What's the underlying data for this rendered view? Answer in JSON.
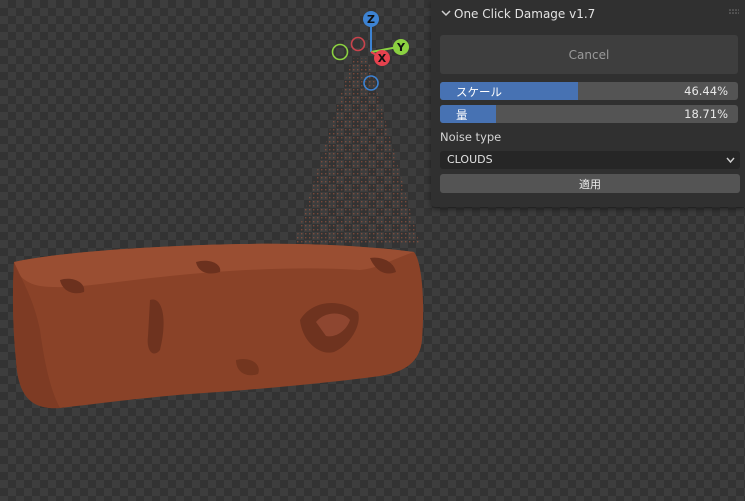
{
  "panel": {
    "title": "One Click Damage v1.7",
    "cancel_label": "Cancel",
    "noise_type_label": "Noise type",
    "noise_type_value": "CLOUDS",
    "apply_label": "適用"
  },
  "sliders": [
    {
      "label": "スケール",
      "value_text": "46.44%",
      "fraction": 0.4644
    },
    {
      "label": "量",
      "value_text": "18.71%",
      "fraction": 0.1871
    }
  ],
  "gizmo": {
    "z_label": "Z",
    "y_label": "Y",
    "x_label": "X"
  },
  "colors": {
    "accent": "#4772b3",
    "object": "#8a4228",
    "axis_x": "#e5424e",
    "axis_y": "#8bd141",
    "axis_z": "#3d83d3"
  }
}
